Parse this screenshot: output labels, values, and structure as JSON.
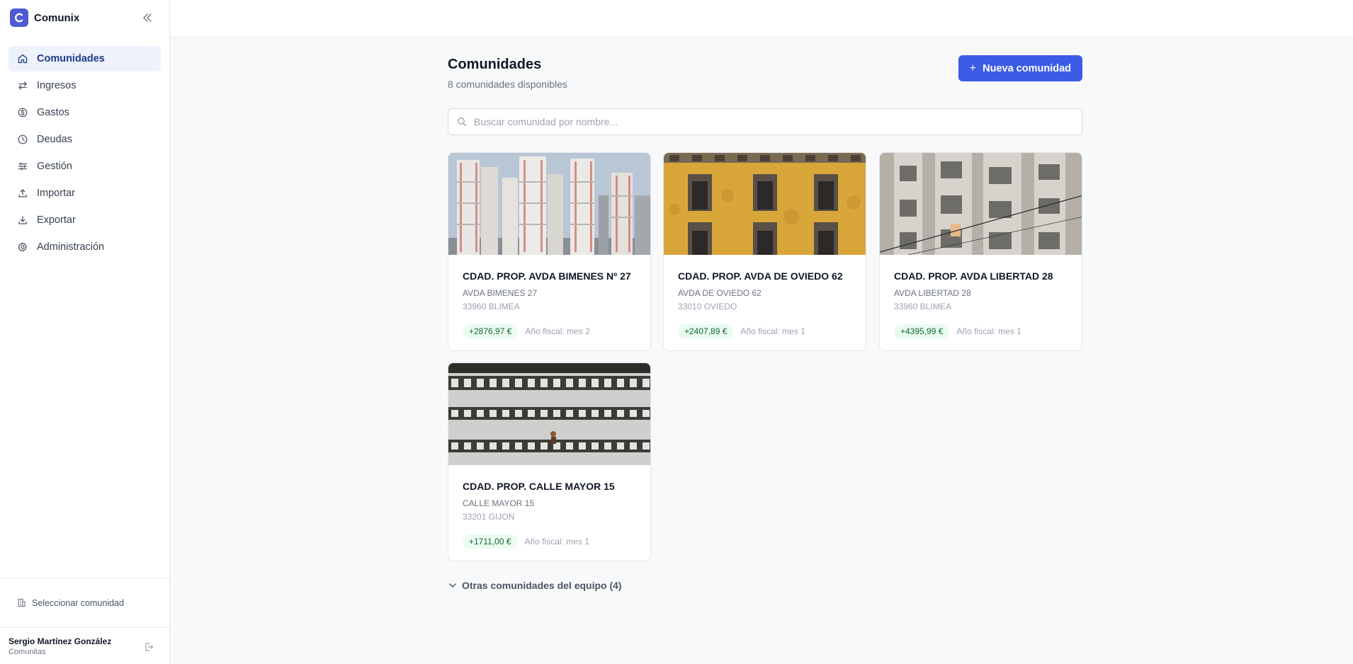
{
  "app": {
    "name": "Comunix"
  },
  "sidebar": {
    "items": [
      {
        "label": "Comunidades",
        "icon": "home-icon"
      },
      {
        "label": "Ingresos",
        "icon": "arrows-exchange-icon"
      },
      {
        "label": "Gastos",
        "icon": "dollar-circle-icon"
      },
      {
        "label": "Deudas",
        "icon": "clock-icon"
      },
      {
        "label": "Gestión",
        "icon": "sliders-icon"
      },
      {
        "label": "Importar",
        "icon": "upload-icon"
      },
      {
        "label": "Exportar",
        "icon": "download-icon"
      },
      {
        "label": "Administración",
        "icon": "gear-icon"
      }
    ],
    "select_community": "Seleccionar comunidad",
    "user": {
      "name": "Sergio Martínez González",
      "org": "Comunitas"
    }
  },
  "page": {
    "title": "Comunidades",
    "subtitle": "8 comunidades disponibles",
    "new_button": "Nueva comunidad",
    "search_placeholder": "Buscar comunidad por nombre...",
    "others_label": "Otras comunidades del equipo (4)"
  },
  "communities": [
    {
      "name": "CDAD. PROP. AVDA BIMENES Nº 27",
      "address": "AVDA BIMENES 27",
      "city": "33960 BLIMEA",
      "balance": "+2876,97 €",
      "fiscal": "Año fiscal: mes 2"
    },
    {
      "name": "CDAD. PROP. AVDA DE OVIEDO 62",
      "address": "AVDA DE OVIEDO 62",
      "city": "33010 OVIEDO",
      "balance": "+2407,89 €",
      "fiscal": "Año fiscal: mes 1"
    },
    {
      "name": "CDAD. PROP. AVDA LIBERTAD 28",
      "address": "AVDA LIBERTAD 28",
      "city": "33960 BLIMEA",
      "balance": "+4395,99 €",
      "fiscal": "Año fiscal: mes 1"
    },
    {
      "name": "CDAD. PROP. CALLE MAYOR 15",
      "address": "CALLE MAYOR 15",
      "city": "33201 GIJON",
      "balance": "+1711,00 €",
      "fiscal": "Año fiscal: mes 1"
    }
  ],
  "colors": {
    "accent": "#3a5ce6",
    "active_bg": "#eef2fb",
    "badge_bg": "#eafbf0",
    "badge_text": "#166534"
  }
}
